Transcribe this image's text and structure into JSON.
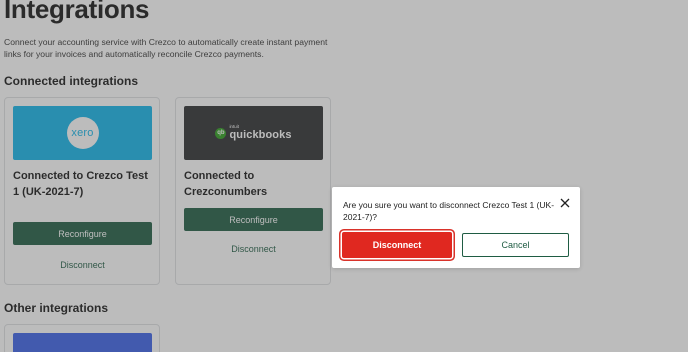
{
  "page": {
    "title": "Integrations",
    "description": "Connect your accounting service with Crezco to automatically create instant payment links for your invoices and automatically reconcile Crezco payments."
  },
  "sections": {
    "connected_title": "Connected integrations",
    "other_title": "Other integrations"
  },
  "cards": [
    {
      "logo_text": "xero",
      "status": "Connected to Crezco Test 1 (UK-2021-7)",
      "reconfigure_label": "Reconfigure",
      "disconnect_label": "Disconnect"
    },
    {
      "logo_intuit": "intuit",
      "logo_text": "quickbooks",
      "logo_mark": "qb",
      "status": "Connected to Crezconumbers",
      "reconfigure_label": "Reconfigure",
      "disconnect_label": "Disconnect"
    }
  ],
  "dialog": {
    "message": "Are you sure you want to disconnect Crezco Test 1 (UK-2021-7)?",
    "confirm_label": "Disconnect",
    "cancel_label": "Cancel",
    "close_icon": "close-icon"
  },
  "colors": {
    "brand_green": "#1f5c43",
    "danger_red": "#e02820",
    "xero_blue": "#13b5ea",
    "quickbooks_dark": "#2d2e30",
    "quickbooks_green": "#2ca01c",
    "other_card_blue": "#3b62e8"
  }
}
